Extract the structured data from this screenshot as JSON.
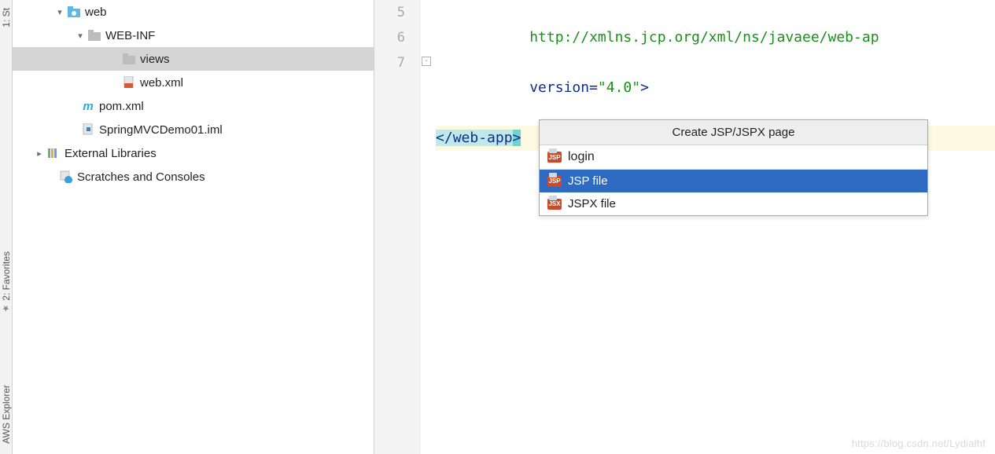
{
  "left_tabs": {
    "top": "1: St",
    "mid": "2: Favorites",
    "bot": "AWS Explorer"
  },
  "tree": {
    "items": [
      {
        "indent": 44,
        "chev": "▾",
        "icon": "webfolder",
        "label": "web"
      },
      {
        "indent": 70,
        "chev": "▾",
        "icon": "folder",
        "label": "WEB-INF"
      },
      {
        "indent": 114,
        "chev": "",
        "icon": "folder",
        "label": "views",
        "selected": true
      },
      {
        "indent": 114,
        "chev": "",
        "icon": "xmlfile",
        "label": "web.xml"
      },
      {
        "indent": 62,
        "chev": "",
        "icon": "maven",
        "label": "pom.xml"
      },
      {
        "indent": 62,
        "chev": "",
        "icon": "imlfile",
        "label": "SpringMVCDemo01.iml"
      },
      {
        "indent": 18,
        "chev": "▸",
        "icon": "lib",
        "label": "External Libraries"
      },
      {
        "indent": 34,
        "chev": "",
        "icon": "scratch",
        "label": "Scratches and Consoles"
      }
    ]
  },
  "gutter": {
    "lines": [
      "5",
      "6",
      "7"
    ]
  },
  "code": {
    "line5": "http://xmlns.jcp.org/xml/ns/javaee/web-ap",
    "line6_attr": "version=",
    "line6_val": "\"4.0\"",
    "line6_close": ">",
    "line7_open": "</",
    "line7_tag": "web-app",
    "line7_close": ">"
  },
  "popup": {
    "title": "Create JSP/JSPX page",
    "input_value": "login",
    "options": [
      {
        "badge": "JSP",
        "label": "JSP file",
        "selected": true
      },
      {
        "badge": "JSX",
        "label": "JSPX file",
        "selected": false
      }
    ]
  },
  "watermark": "https://blog.csdn.net/Lydialhf"
}
